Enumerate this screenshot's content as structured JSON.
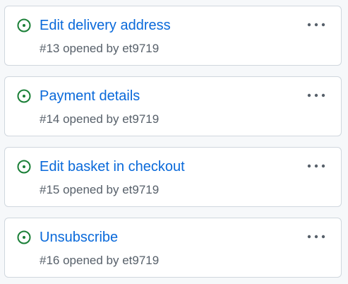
{
  "colors": {
    "open_status": "#1a7f37",
    "title_link": "#0969da",
    "meta_text": "#57606a",
    "card_border": "#d0d7de",
    "page_background": "#f6f8fa"
  },
  "icons": {
    "status": "issue-opened-icon",
    "menu": "kebab-horizontal-icon"
  },
  "issues": [
    {
      "title": "Edit delivery address",
      "meta": "#13 opened by et9719"
    },
    {
      "title": "Payment details",
      "meta": "#14 opened by et9719"
    },
    {
      "title": "Edit basket in checkout",
      "meta": "#15 opened by et9719"
    },
    {
      "title": "Unsubscribe",
      "meta": "#16 opened by et9719"
    }
  ]
}
